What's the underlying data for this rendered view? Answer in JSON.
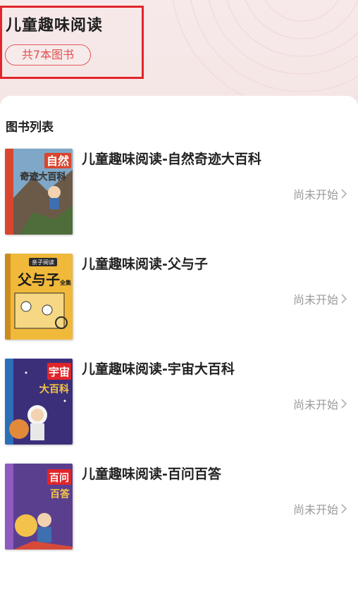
{
  "header": {
    "title": "儿童趣味阅读",
    "count_badge": "共7本图书"
  },
  "section": {
    "title": "图书列表"
  },
  "books": [
    {
      "title": "儿童趣味阅读-自然奇迹大百科",
      "status": "尚未开始",
      "cover_text_line1": "自然",
      "cover_text_line2": "奇迹大百科",
      "cover_color": "#d9462f"
    },
    {
      "title": "儿童趣味阅读-父与子",
      "status": "尚未开始",
      "cover_text_top": "亲子阅读",
      "cover_text_main": "父与子",
      "cover_text_side": "全集",
      "cover_color": "#f1b93a"
    },
    {
      "title": "儿童趣味阅读-宇宙大百科",
      "status": "尚未开始",
      "cover_text_line1": "宇宙",
      "cover_text_line2": "大百科",
      "cover_color": "#3b2f7a"
    },
    {
      "title": "儿童趣味阅读-百问百答",
      "status": "尚未开始",
      "cover_text_line1": "百问",
      "cover_text_line2": "百答",
      "cover_color": "#5b3f8f"
    }
  ],
  "colors": {
    "accent_red": "#e0262a",
    "badge_red": "#e05050",
    "status_gray": "#9a9a9a"
  }
}
